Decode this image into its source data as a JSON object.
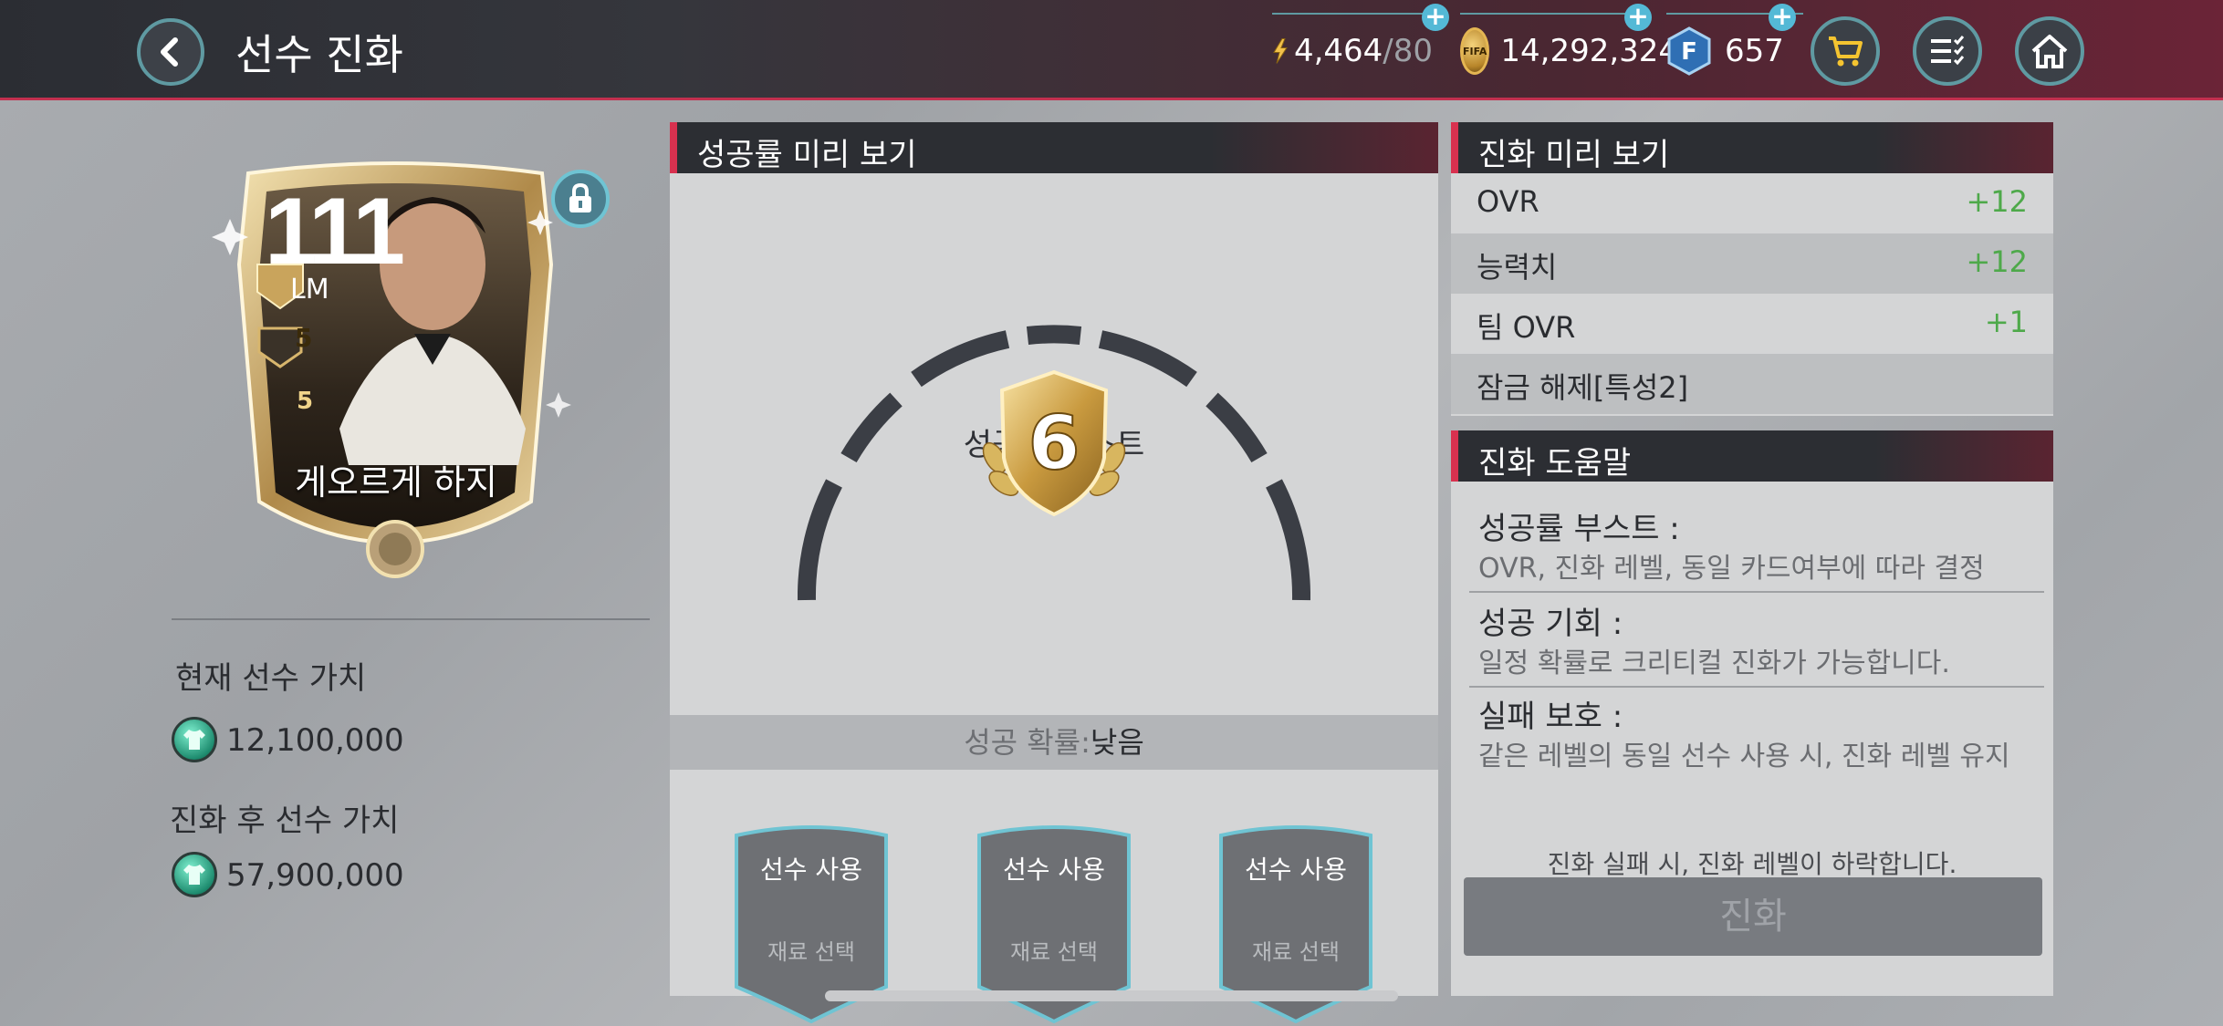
{
  "header": {
    "title": "선수 진화",
    "stamina_value": "4,464",
    "stamina_cap": "/80",
    "coins": "14,292,324",
    "coin_text": "FIFA",
    "fifa_points": "657",
    "fp_letter": "F",
    "plus": "+"
  },
  "player_card": {
    "ovr": "111",
    "position": "LM",
    "rank_top": "5",
    "rank_bottom": "5",
    "name": "게오르게 하지"
  },
  "values": {
    "current_label": "현재 선수 가치",
    "current_amount": "12,100,000",
    "after_label": "진화 후 선수 가치",
    "after_amount": "57,900,000"
  },
  "success_preview": {
    "title": "성공률 미리 보기",
    "boost_label": "성공률 부스트",
    "boost_value": "6",
    "probability_prefix": "성공 확률:",
    "probability_value": "낮음",
    "slots": [
      {
        "title": "선수 사용",
        "subtitle": "재료 선택"
      },
      {
        "title": "선수 사용",
        "subtitle": "재료 선택"
      },
      {
        "title": "선수 사용",
        "subtitle": "재료 선택"
      }
    ]
  },
  "evolution_preview": {
    "title": "진화 미리 보기",
    "rows": [
      {
        "label": "OVR",
        "value": "+12"
      },
      {
        "label": "능력치",
        "value": "+12"
      },
      {
        "label": "팀 OVR",
        "value": "+1"
      },
      {
        "label": "잠금 해제[특성2]",
        "value": ""
      }
    ]
  },
  "help": {
    "title": "진화 도움말",
    "items": [
      {
        "title": "성공률 부스트 :",
        "desc": "OVR, 진화 레벨, 동일 카드여부에 따라 결정"
      },
      {
        "title": "성공 기회 :",
        "desc": "일정 확률로 크리티컬 진화가 가능합니다."
      },
      {
        "title": "실패 보호 :",
        "desc": "같은 레벨의 동일 선수 사용 시, 진화 레벨 유지"
      }
    ],
    "fail_note": "진화 실패 시, 진화 레벨이 하락합니다.",
    "evolve_button": "진화"
  },
  "colors": {
    "accent_red": "#d8314f",
    "teal_border": "#5f9aa2",
    "positive_green": "#4ea94a"
  }
}
